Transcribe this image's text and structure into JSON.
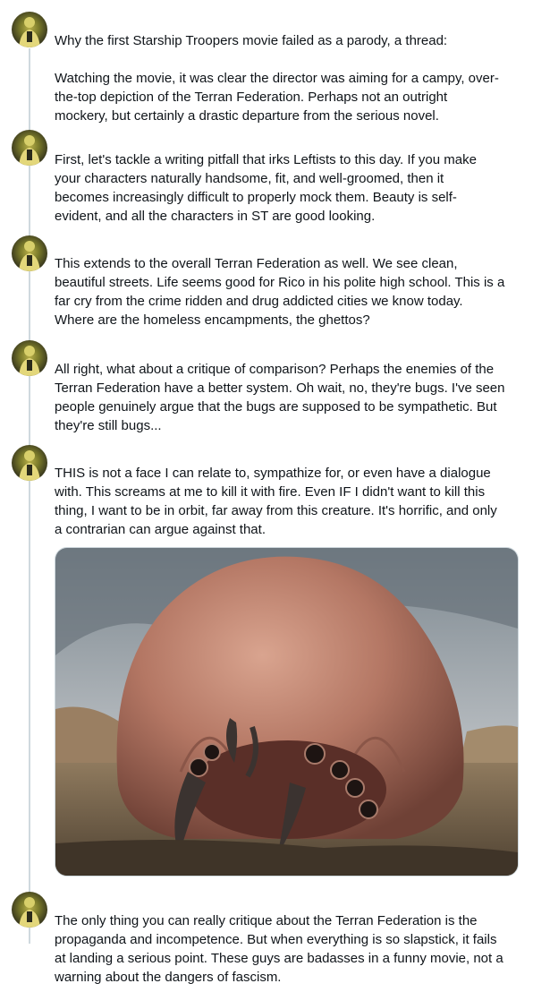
{
  "thread": {
    "tweets": [
      {
        "text": "Why the first Starship Troopers movie failed as a parody, a thread:\n\nWatching the movie, it was clear the director was aiming for a campy, over-\nthe-top depiction of the Terran Federation. Perhaps not an outright\nmockery, but certainly a drastic departure from the serious novel."
      },
      {
        "text": "First, let's tackle a writing pitfall that irks Leftists to this day. If you make\nyour characters naturally handsome, fit, and well-groomed, then it\nbecomes increasingly difficult to properly mock them. Beauty is self-\nevident, and all the characters in ST are good looking."
      },
      {
        "text": "This extends to the overall Terran Federation as well. We see clean,\nbeautiful streets. Life seems good for Rico in his polite high school. This is a\nfar cry from the crime ridden and drug addicted cities we know today.\nWhere are the homeless encampments, the ghettos?"
      },
      {
        "text": "All right, what about a critique of comparison? Perhaps the enemies of the\nTerran Federation have a better system. Oh wait, no, they're bugs. I've seen\npeople genuinely argue that the bugs are supposed to be sympathetic. But\nthey're still bugs..."
      },
      {
        "text": "THIS is not a face I can relate to, sympathize for, or even have a dialogue\nwith. This screams at me to kill it with fire. Even IF I didn't want to kill this\nthing, I want to be in orbit, far away from this creature. It's horrific, and only\na contrarian can argue against that."
      },
      {
        "text": "The only thing you can really critique about the Terran Federation is the\npropaganda and incompetence. But when everything is so slapstick, it fails\nat landing a serious point. These guys are badasses in a funny movie, not a\nwarning about the dangers of fascism."
      }
    ]
  },
  "colors": {
    "thread_line": "#cfd9de",
    "text": "#0f1419"
  }
}
